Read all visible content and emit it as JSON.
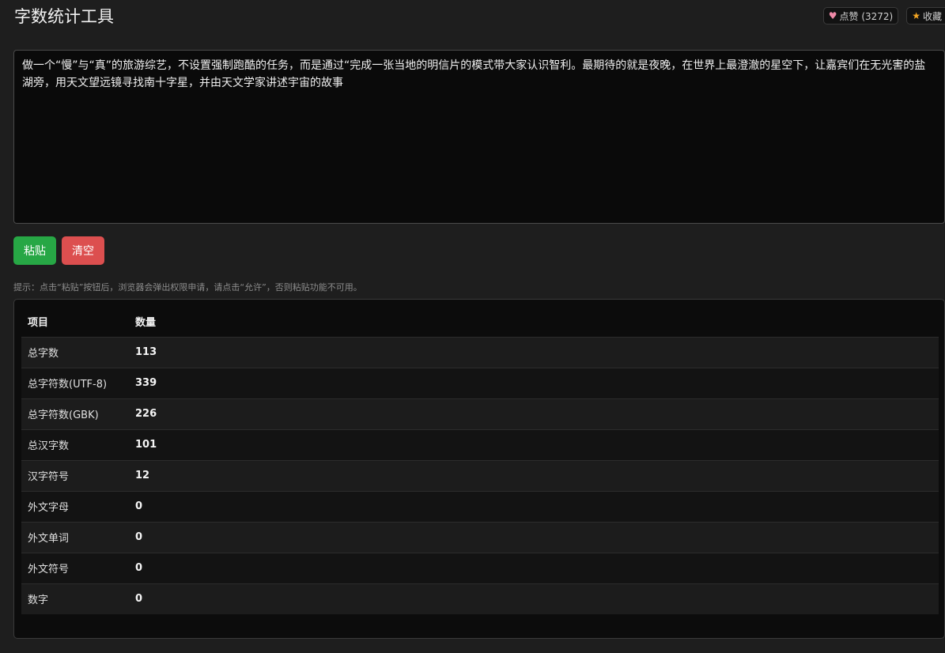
{
  "header": {
    "title": "字数统计工具",
    "like_label": "点赞 (3272)",
    "favorite_label": "收藏",
    "like_icon": "heart-icon",
    "favorite_icon": "star-icon"
  },
  "editor": {
    "value": "做一个“慢”与“真”的旅游综艺，不设置强制跑酷的任务，而是通过“完成一张当地的明信片的模式带大家认识智利。最期待的就是夜晚，在世界上最澄澈的星空下，让嘉宾们在无光害的盐湖旁，用天文望远镜寻找南十字星，并由天文学家讲述宇宙的故事"
  },
  "buttons": {
    "paste": "粘贴",
    "clear": "清空"
  },
  "hint": "提示：点击“粘贴”按钮后，浏览器会弹出权限申请，请点击“允许”，否则粘贴功能不可用。",
  "table": {
    "headers": [
      "项目",
      "数量"
    ],
    "rows": [
      {
        "item": "总字数",
        "count": "113"
      },
      {
        "item": "总字符数(UTF-8)",
        "count": "339"
      },
      {
        "item": "总字符数(GBK)",
        "count": "226"
      },
      {
        "item": "总汉字数",
        "count": "101"
      },
      {
        "item": "汉字符号",
        "count": "12"
      },
      {
        "item": "外文字母",
        "count": "0"
      },
      {
        "item": "外文单词",
        "count": "0"
      },
      {
        "item": "外文符号",
        "count": "0"
      },
      {
        "item": "数字",
        "count": "0"
      }
    ]
  },
  "colors": {
    "paste_button": "#27a745",
    "clear_button": "#dc4f4f",
    "heart": "#f08aa8",
    "star": "#f5a623"
  }
}
